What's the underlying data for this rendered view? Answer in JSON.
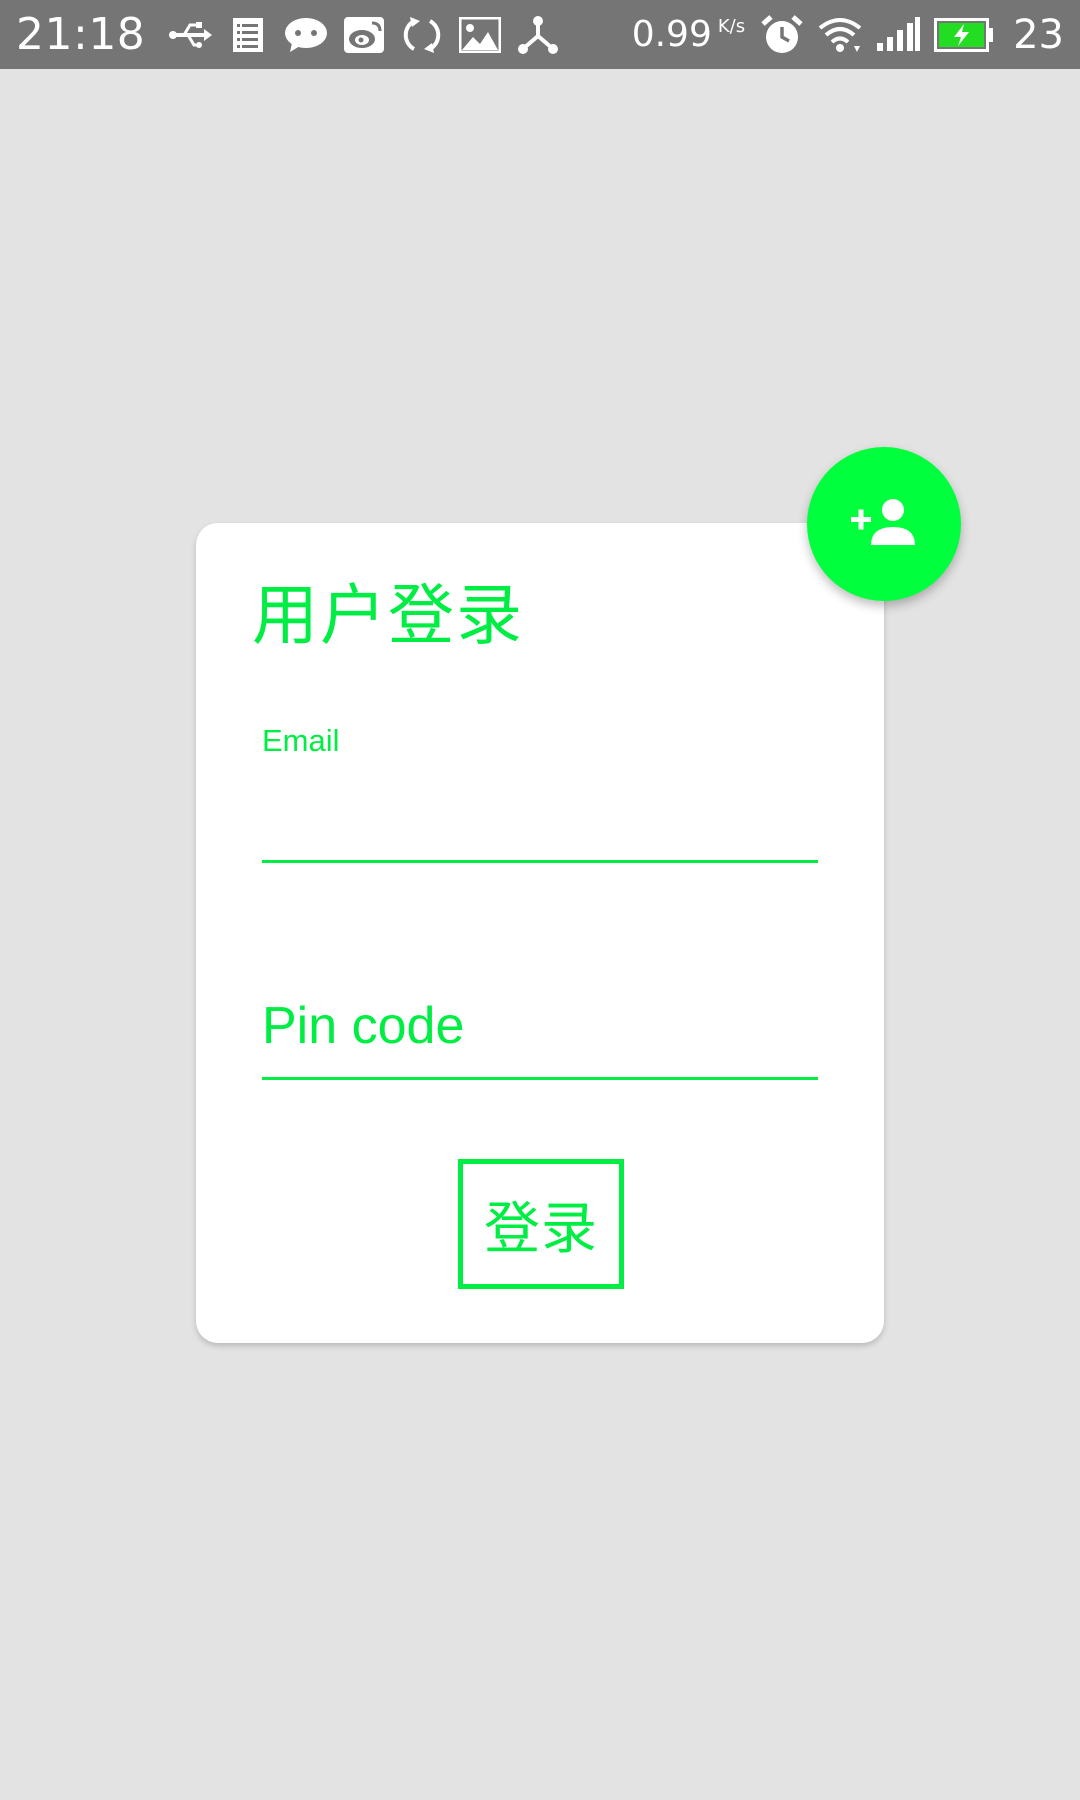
{
  "status_bar": {
    "time": "21:18",
    "left_icons": [
      "usb-icon",
      "list-icon",
      "wechat-icon",
      "weibo-icon",
      "sync-icon",
      "image-icon",
      "share-icon"
    ],
    "network_speed": "0.99",
    "network_speed_unit": "K/s",
    "right_icons": [
      "alarm-icon",
      "wifi-icon",
      "signal-icon",
      "battery-charging-icon"
    ],
    "battery_percent": "23"
  },
  "login_card": {
    "title": "用户登录",
    "email": {
      "label": "Email",
      "value": ""
    },
    "pin": {
      "placeholder": "Pin code",
      "value": ""
    },
    "submit_label": "登录"
  },
  "fab": {
    "icon": "add-person-icon"
  },
  "colors": {
    "accent": "#00ee44",
    "fab_background": "#00ff3c",
    "page_background": "#e3e3e3",
    "status_bar_background": "#757575",
    "card_background": "#ffffff"
  }
}
